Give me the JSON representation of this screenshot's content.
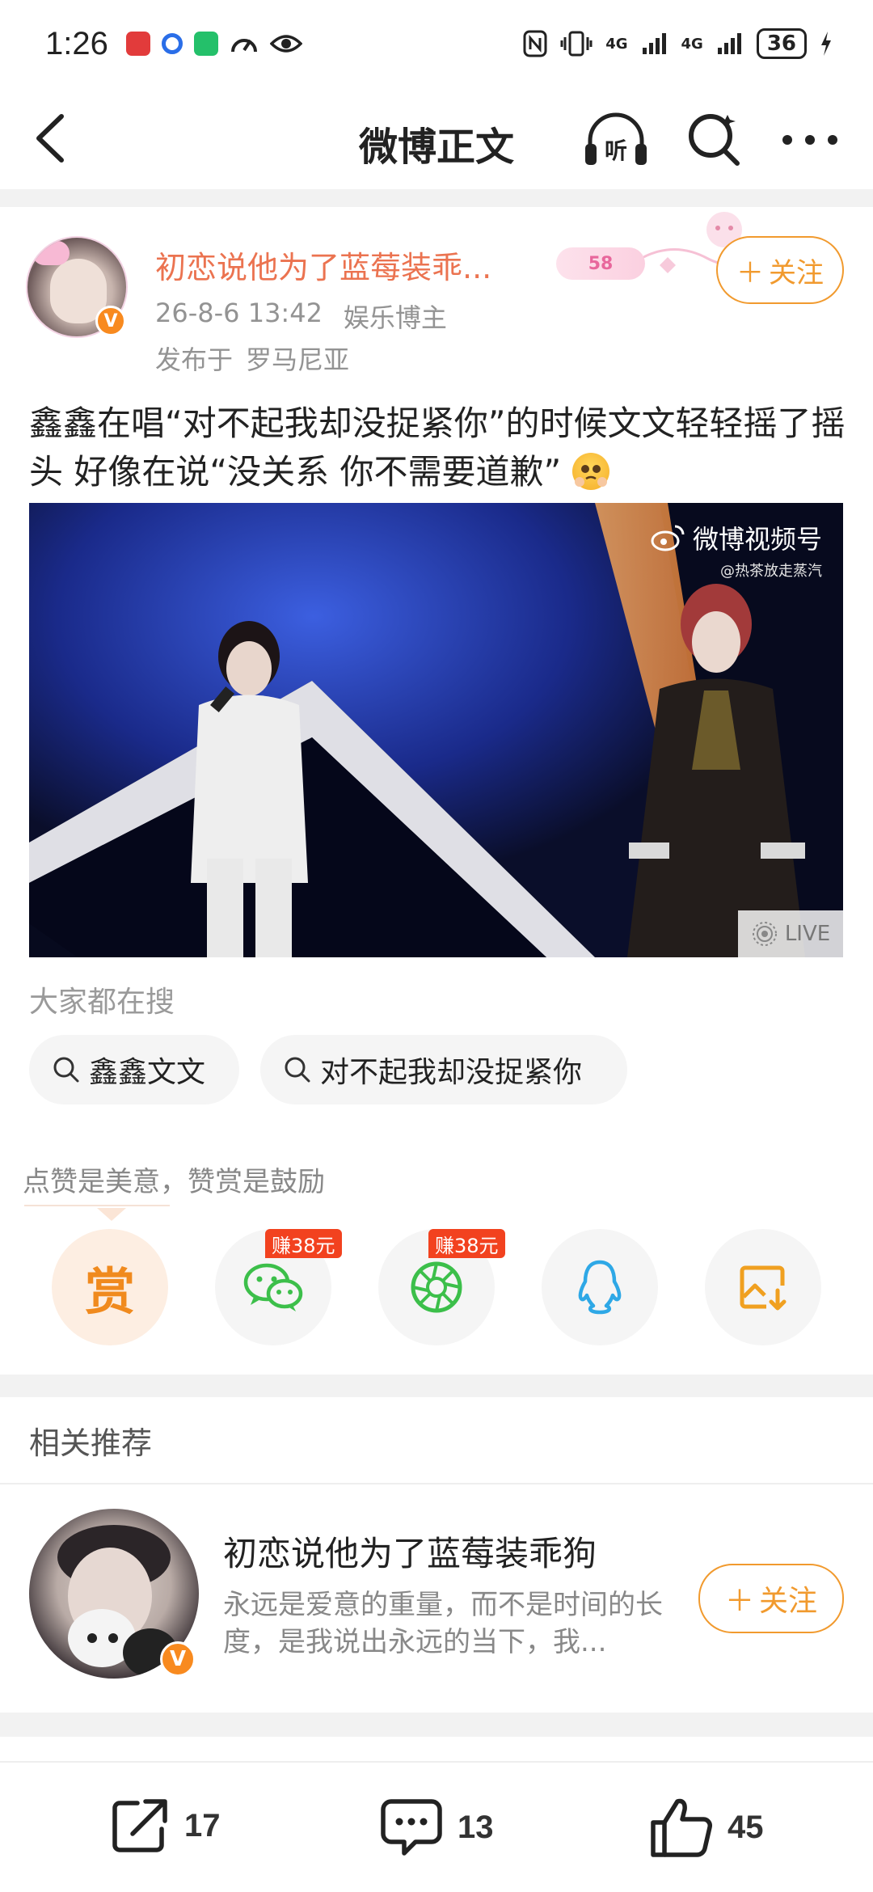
{
  "status_bar": {
    "time": "1:26",
    "network_1": "4G",
    "network_2": "4G",
    "battery": "36"
  },
  "nav": {
    "title": "微博正文",
    "listen_label": "听"
  },
  "post": {
    "author_name": "初恋说他为了蓝莓装乖...",
    "svip_level": "58",
    "follow_label": "关注",
    "timestamp": "26-8-6 13:42",
    "author_tag": "娱乐博主",
    "location_prefix": "发布于",
    "location": "罗马尼亚",
    "text": "鑫鑫在唱“对不起我却没捉紧你”的时候文文轻轻摇了摇头 好像在说“没关系 你不需要道歉”",
    "verified_badge": "V"
  },
  "video": {
    "watermark": "微博视频号",
    "watermark_sub": "@热茶放走蒸汽",
    "live_label": "LIVE"
  },
  "hot_search": {
    "label": "大家都在搜",
    "items": [
      "鑫鑫文文",
      "对不起我却没捉紧你"
    ]
  },
  "reward": {
    "tip": "点赞是美意，赞赏是鼓励",
    "reward_label": "赏",
    "earn_wechat": "赚38元",
    "earn_moments": "赚38元"
  },
  "related": {
    "title": "相关推荐",
    "name": "初恋说他为了蓝莓装乖狗",
    "desc": "永远是爱意的重量，而不是时间的长度，是我说出永远的当下，我...",
    "follow_label": "关注"
  },
  "bottom_bar": {
    "reposts": "17",
    "comments": "13",
    "likes": "45"
  },
  "colors": {
    "accent_orange": "#f19a2e",
    "author_orange": "#eb7350",
    "earn_red": "#f2421f",
    "wechat_green": "#3cbf4a",
    "qq_blue": "#2ea8e6"
  }
}
